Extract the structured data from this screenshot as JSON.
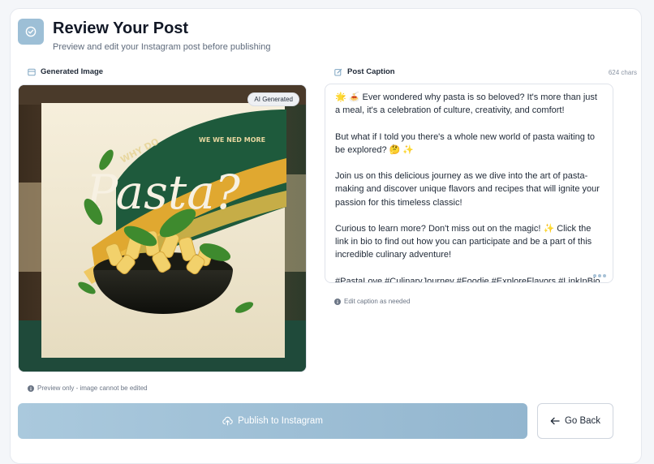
{
  "header": {
    "title": "Review Your Post",
    "subtitle": "Preview and edit your Instagram post before publishing",
    "icon": "check-circle-icon"
  },
  "image_section": {
    "label": "Generated Image",
    "badge": "AI Generated",
    "hint": "Preview only - image cannot be edited",
    "artwork_text": {
      "top": "WHY DO",
      "arc": "WE WE NED MORE",
      "main": "Pasta?"
    }
  },
  "caption_section": {
    "label": "Post Caption",
    "char_count": "624 chars",
    "text": "🌟 🍝 Ever wondered why pasta is so beloved? It's more than just a meal, it's a celebration of culture, creativity, and comfort!\n\nBut what if I told you there's a whole new world of pasta waiting to be explored? 🤔 ✨\n\nJoin us on this delicious journey as we dive into the art of pasta-making and discover unique flavors and recipes that will ignite your passion for this timeless classic!\n\nCurious to learn more? Don't miss out on the magic! ✨ Click the link in bio to find out how you can participate and be a part of this incredible culinary adventure!\n\n#PastaLove #CulinaryJourney #Foodie #ExploreFlavors #LinkInBio ✨",
    "hint": "Edit caption as needed"
  },
  "actions": {
    "publish_label": "Publish to Instagram",
    "back_label": "Go Back"
  },
  "colors": {
    "accent": "#9dbfd6",
    "publish": "#93b6cf"
  }
}
